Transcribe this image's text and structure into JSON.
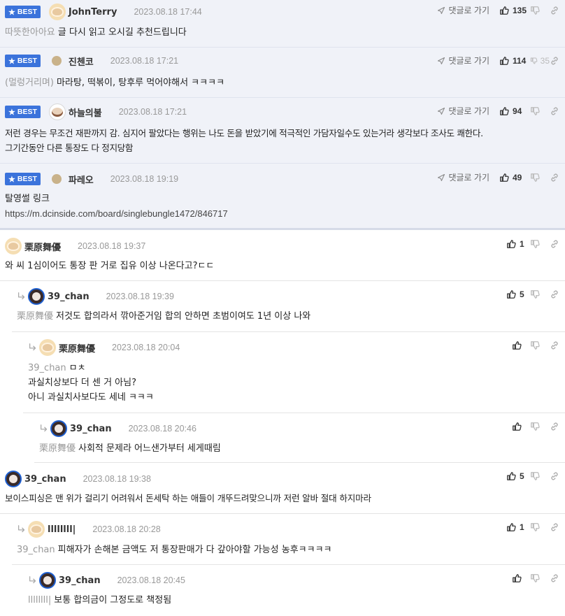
{
  "best_comments": [
    {
      "badge": "BEST",
      "user": "JohnTerry",
      "date": "2023.08.18 17:44",
      "reply_label": "댓글로 가기",
      "upvotes": "135",
      "downvotes": "",
      "mention": "따뜻한아아요",
      "text": "글 다시 읽고 오시길 추천드립니다"
    },
    {
      "badge": "BEST",
      "user": "진첸코",
      "date": "2023.08.18 17:21",
      "reply_label": "댓글로 가기",
      "upvotes": "114",
      "downvotes": "35",
      "mention": "(멀렁거리며)",
      "text": "마라탕, 떡볶이, 탕후루 먹어야해서 ㅋㅋㅋㅋ"
    },
    {
      "badge": "BEST",
      "user": "하늘의불",
      "date": "2023.08.18 17:21",
      "reply_label": "댓글로 가기",
      "upvotes": "94",
      "downvotes": "",
      "text_line1": "저런 경우는 무조건 재판까지 감. 심지어 팔았다는 행위는 나도 돈을 받았기에 적극적인 가담자일수도 있는거라 생각보다 조사도 쾌한다.",
      "text_line2": "그기간동안 다른 통장도 다 정지당함"
    },
    {
      "badge": "BEST",
      "user": "파레오",
      "date": "2023.08.18 19:19",
      "reply_label": "댓글로 가기",
      "upvotes": "49",
      "downvotes": "",
      "text": "탈영썰 링크",
      "url": "https://m.dcinside.com/board/singlebungle1472/846717"
    }
  ],
  "comments": [
    {
      "user": "栗原舞優",
      "date": "2023.08.18 19:37",
      "upvotes": "1",
      "text": "와 씨 1심이어도 통장 판 거로 집유 이상 나온다고?ㄷㄷ"
    },
    {
      "user": "39_chan",
      "date": "2023.08.18 19:39",
      "upvotes": "5",
      "mention": "栗原舞優",
      "text": "저것도 합의라서 깎아준거임 합의 안하면 초범이여도 1년 이상 나와"
    },
    {
      "user": "栗原舞優",
      "date": "2023.08.18 20:04",
      "upvotes": "",
      "mention": "39_chan",
      "text_line1": "ㅁㅊ",
      "text_line2": "과실치상보다 더 센 거 아님?",
      "text_line3": "아니 과실치사보다도 세네 ㅋㅋㅋ"
    },
    {
      "user": "39_chan",
      "date": "2023.08.18 20:46",
      "upvotes": "",
      "mention": "栗原舞優",
      "text": "사회적 문제라 어느샌가부터 세게때림"
    },
    {
      "user": "39_chan",
      "date": "2023.08.18 19:38",
      "upvotes": "5",
      "text": "보이스피싱은 맨 위가 걸리기 어려워서 돈세탁 하는 애들이 개뚜드려맞으니까 저런 알바 절대 하지마라"
    },
    {
      "user": "llllllll|",
      "date": "2023.08.18 20:28",
      "upvotes": "1",
      "mention": "39_chan",
      "text": "피해자가 손해본 금액도 저 통장판매가 다 갚아야할 가능성 농후ㅋㅋㅋㅋ"
    },
    {
      "user": "39_chan",
      "date": "2023.08.18 20:45",
      "upvotes": "",
      "mention": "llllllll|",
      "text": "보통 합의금이 그정도로 책정됨"
    }
  ],
  "icons": {
    "reply": "reply-arrow-icon",
    "up": "thumbs-up-icon",
    "down": "thumbs-down-icon",
    "link": "link-icon",
    "badge_star": "star-icon",
    "nest": "nested-reply-arrow-icon"
  },
  "colors": {
    "best_badge": "#3b73db",
    "best_bg": "#f0f2f8"
  }
}
